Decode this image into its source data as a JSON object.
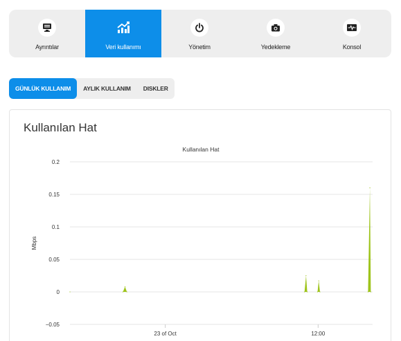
{
  "nav": {
    "items": [
      {
        "label": "Ayrıntılar",
        "icon": "monitor-icon",
        "active": false
      },
      {
        "label": "Veri kullanımı",
        "icon": "chart-icon",
        "active": true
      },
      {
        "label": "Yönetim",
        "icon": "power-icon",
        "active": false
      },
      {
        "label": "Yedekleme",
        "icon": "camera-icon",
        "active": false
      },
      {
        "label": "Konsol",
        "icon": "console-icon",
        "active": false
      }
    ]
  },
  "subtabs": [
    {
      "label": "GÜNLÜK KULLANIM",
      "active": true
    },
    {
      "label": "AYLIK KULLANIM",
      "active": false
    },
    {
      "label": "DISKLER",
      "active": false
    }
  ],
  "card": {
    "title": "Kullanılan Hat"
  },
  "colors": {
    "accent": "#0d8ee9",
    "area": "#9ec41c"
  },
  "chart_data": {
    "type": "area",
    "title": "Kullanılan Hat",
    "ylabel": "Mbps",
    "xlabel": "",
    "ylim": [
      -0.05,
      0.2
    ],
    "yticks": [
      -0.05,
      0,
      0.05,
      0.1,
      0.15,
      0.2
    ],
    "ytick_labels": [
      "−0.05",
      "0",
      "0.05",
      "0.1",
      "0.15",
      "0.2"
    ],
    "xlim": [
      0,
      100
    ],
    "xticks": [
      {
        "x": 31.5,
        "label": "23 of Oct"
      },
      {
        "x": 82,
        "label": "12:00"
      }
    ],
    "grid": true,
    "series": [
      {
        "values": [
          [
            0,
            0
          ],
          [
            17.5,
            0
          ],
          [
            18.2,
            0.008
          ],
          [
            18.8,
            0
          ],
          [
            77.5,
            0
          ],
          [
            78,
            0.025
          ],
          [
            78.4,
            0
          ],
          [
            81.8,
            0
          ],
          [
            82.2,
            0.017
          ],
          [
            82.6,
            0
          ],
          [
            98.5,
            0
          ],
          [
            99.1,
            0.16
          ],
          [
            99.4,
            0
          ]
        ]
      }
    ]
  }
}
